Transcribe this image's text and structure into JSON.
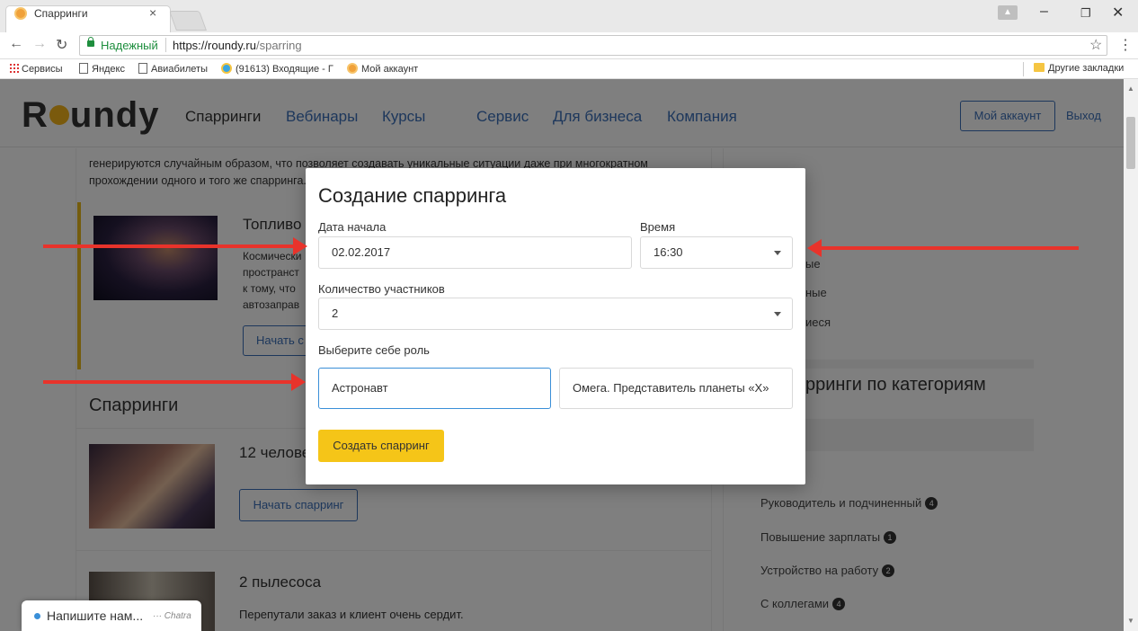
{
  "browser": {
    "tab_title": "Спарринги",
    "tab_close": "×",
    "secure_label": "Надежный",
    "url_host": "https://roundy.ru",
    "url_path": "/sparring",
    "bookmarks": [
      {
        "label": "Сервисы"
      },
      {
        "label": "Яндекс"
      },
      {
        "label": "Авиабилеты"
      },
      {
        "label": "(91613) Входящие - Г"
      },
      {
        "label": "Мой аккаунт"
      }
    ],
    "other_bookmarks": "Другие закладки"
  },
  "site": {
    "logo_pre": "R",
    "logo_post": "undy",
    "nav": [
      {
        "label": "Спарринги",
        "active": true
      },
      {
        "label": "Вебинары"
      },
      {
        "label": "Курсы"
      },
      {
        "label": "Сервис"
      },
      {
        "label": "Для бизнеса"
      },
      {
        "label": "Компания"
      }
    ],
    "account_button": "Мой аккаунт",
    "logout": "Выход"
  },
  "main": {
    "intro_line1": "генерируются случайным образом, что позволяет создавать уникальные ситуации даже при многократном",
    "intro_line2": "прохождении одного и того же спарринга.",
    "featured_title": "Топливо",
    "featured_lines": [
      "Космически",
      "пространст",
      "к тому, что",
      "автозаправ"
    ],
    "featured_button": "Начать с",
    "section_title": "Спарринги",
    "items": [
      {
        "title": "12 челове",
        "button": "Начать спарринг"
      },
      {
        "title": "2 пылесоса",
        "desc": "Перепутали заказ и клиент очень сердит."
      }
    ]
  },
  "sidebar": {
    "partial_items": [
      "ые",
      "ные",
      "иеся"
    ],
    "categories_title": "рринги по категориям",
    "categories": [
      {
        "label": "Руководитель и подчиненный",
        "count": "4"
      },
      {
        "label": "Повышение зарплаты",
        "count": "1"
      },
      {
        "label": "Устройство на работу",
        "count": "2"
      },
      {
        "label": "С коллегами",
        "count": "4"
      }
    ]
  },
  "modal": {
    "title": "Создание спарринга",
    "date_label": "Дата начала",
    "date_value": "02.02.2017",
    "time_label": "Время",
    "time_value": "16:30",
    "participants_label": "Количество участников",
    "participants_value": "2",
    "role_label": "Выберите себе роль",
    "roles": [
      {
        "label": "Астронавт",
        "selected": true
      },
      {
        "label": "Омега. Представитель планеты «Х»"
      }
    ],
    "create_button": "Создать спарринг"
  },
  "chat": {
    "prompt": "Напишите нам...",
    "brand": "Chatra"
  },
  "colors": {
    "accent_yellow": "#f5c518",
    "link_blue": "#3a6fb8",
    "annotation_red": "#e8332b"
  }
}
